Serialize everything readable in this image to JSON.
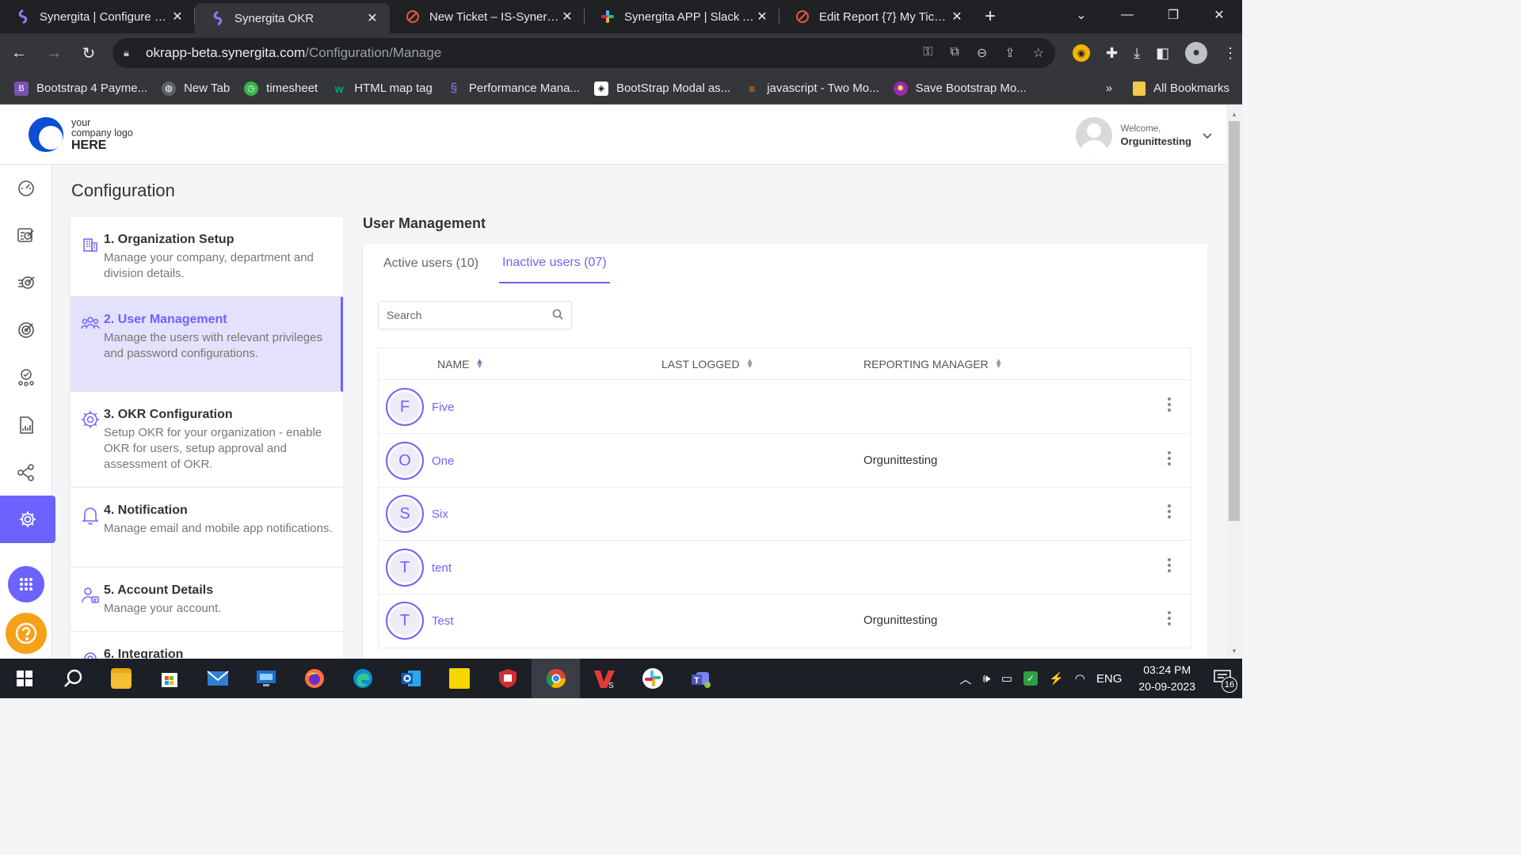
{
  "browser": {
    "tabs": [
      {
        "title": "Synergita | Configure OKR",
        "favicon": "synergita-icon",
        "active": false
      },
      {
        "title": "Synergita OKR",
        "favicon": "synergita-icon",
        "active": true
      },
      {
        "title": "New Ticket – IS-Synergita",
        "favicon": "ticket-icon",
        "active": false
      },
      {
        "title": "Synergita APP | Slack App",
        "favicon": "slack-icon",
        "active": false
      },
      {
        "title": "Edit Report {7} My Tickets",
        "favicon": "ticket-icon",
        "active": false
      }
    ],
    "new_tab": "+",
    "close_glyph": "✕",
    "url_host": "okrapp-beta.synergita.com",
    "url_path": "/Configuration/Manage",
    "bookmarks": [
      {
        "label": "Bootstrap 4 Payme...",
        "icon": "bootstrap-icon",
        "color": "#7952b3"
      },
      {
        "label": "New Tab",
        "icon": "globe-icon",
        "color": "#5f6368"
      },
      {
        "label": "timesheet",
        "icon": "timesheet-icon",
        "color": "#3ab54a"
      },
      {
        "label": "HTML map tag",
        "icon": "w3-icon",
        "color": "#04aa6d"
      },
      {
        "label": "Performance Mana...",
        "icon": "synergita-icon",
        "color": "#5b4fd6"
      },
      {
        "label": "BootStrap Modal as...",
        "icon": "codepen-icon",
        "color": "#444"
      },
      {
        "label": "javascript - Two Mo...",
        "icon": "stackoverflow-icon",
        "color": "#f48024"
      },
      {
        "label": "Save Bootstrap Mo...",
        "icon": "sun-icon",
        "color": "#9c27b0"
      }
    ],
    "bookmarks_more": "»",
    "all_bookmarks": "All Bookmarks"
  },
  "header": {
    "logo_line1": "your",
    "logo_line2": "company logo",
    "logo_line3": "HERE",
    "welcome": "Welcome,",
    "username": "Orgunittesting"
  },
  "page": {
    "title": "Configuration"
  },
  "config_menu": [
    {
      "title": "1. Organization Setup",
      "desc": "Manage your company, department and division details.",
      "icon": "building-icon",
      "active": false
    },
    {
      "title": "2. User Management",
      "desc": "Manage the users with relevant privileges and password configurations.",
      "icon": "users-icon",
      "active": true
    },
    {
      "title": "3. OKR Configuration",
      "desc": "Setup OKR for your organization - enable OKR for users, setup approval and assessment of OKR.",
      "icon": "gear-icon",
      "active": false
    },
    {
      "title": "4. Notification",
      "desc": "Manage email and mobile app notifications.",
      "icon": "bell-icon",
      "active": false
    },
    {
      "title": "5. Account Details",
      "desc": "Manage your account.",
      "icon": "account-icon",
      "active": false
    },
    {
      "title": "6. Integration",
      "desc": "",
      "icon": "integration-icon",
      "active": false
    }
  ],
  "user_management": {
    "title": "User Management",
    "tabs": [
      {
        "label": "Active users (10)",
        "active": false
      },
      {
        "label": "Inactive users (07)",
        "active": true
      }
    ],
    "search_placeholder": "Search",
    "columns": [
      "NAME",
      "LAST LOGGED",
      "REPORTING MANAGER"
    ],
    "rows": [
      {
        "initial": "F",
        "name": "Five",
        "last_logged": "",
        "manager": ""
      },
      {
        "initial": "O",
        "name": "One",
        "last_logged": "",
        "manager": "Orgunittesting"
      },
      {
        "initial": "S",
        "name": "Six",
        "last_logged": "",
        "manager": ""
      },
      {
        "initial": "T",
        "name": "tent",
        "last_logged": "",
        "manager": ""
      },
      {
        "initial": "T",
        "name": "Test",
        "last_logged": "",
        "manager": "Orgunittesting"
      }
    ]
  },
  "taskbar": {
    "time": "03:24 PM",
    "date": "20-09-2023",
    "lang": "ENG",
    "notifications": "16"
  },
  "colors": {
    "accent": "#6c63ff",
    "active_menu_bg": "#e3e1fb",
    "help_orange": "#f7a11a"
  }
}
